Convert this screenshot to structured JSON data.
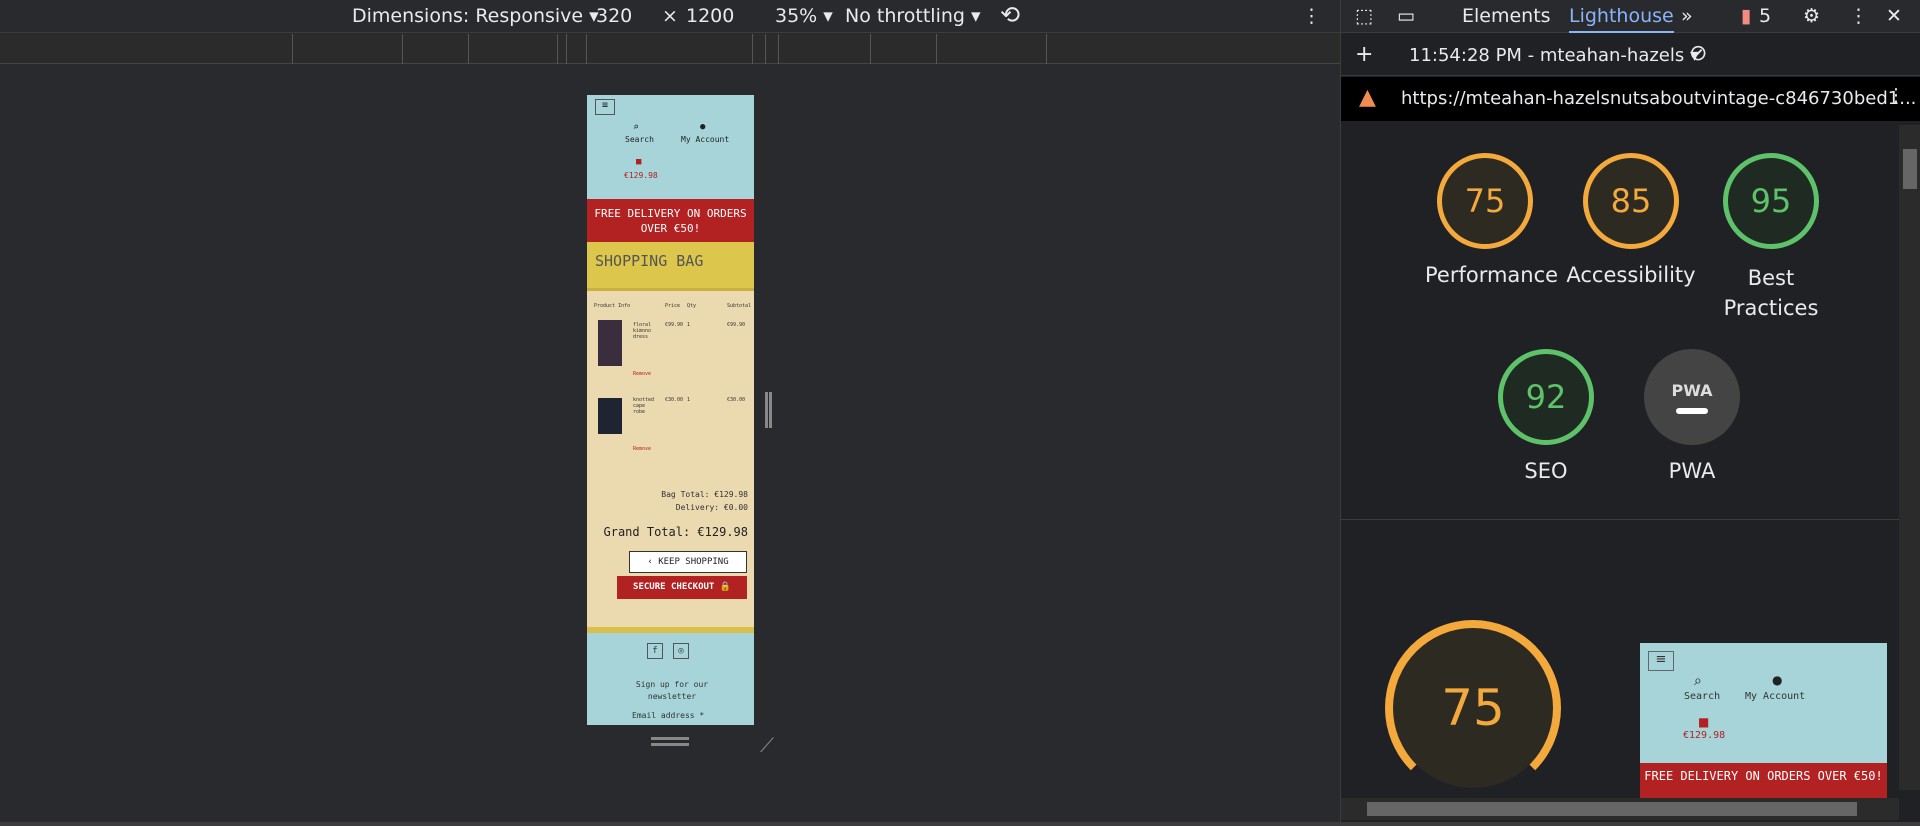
{
  "devtools_toolbar": {
    "dimensions_label": "Dimensions: Responsive",
    "width": "320",
    "times": "×",
    "height": "1200",
    "zoom": "35%",
    "throttling": "No throttling"
  },
  "viewport": {
    "header": {
      "search_label": "Search",
      "account_label": "My Account",
      "bag_total": "€129.98"
    },
    "promo": "FREE DELIVERY ON ORDERS OVER €50!",
    "title": "SHOPPING BAG",
    "table_headers": [
      "Product Info",
      "Price",
      "Qty",
      "Subtotal"
    ],
    "items": [
      {
        "name": "floral kimono dress",
        "price": "€99.90",
        "qty": "1",
        "subtotal": "€99.90",
        "remove": "Remove"
      },
      {
        "name": "knotted cape robe",
        "price": "€30.00",
        "qty": "1",
        "subtotal": "€30.00",
        "remove": "Remove"
      }
    ],
    "bag_total": "Bag Total: €129.98",
    "delivery": "Delivery: €0.00",
    "grand_total": "Grand Total: €129.98",
    "keep_shopping": "KEEP SHOPPING",
    "secure_checkout": "SECURE CHECKOUT",
    "footer": {
      "newsletter": "Sign up for our newsletter",
      "email_label": "Email address *"
    }
  },
  "devtools_panel": {
    "tabs": [
      "Elements",
      "Lighthouse"
    ],
    "active_tab": "Lighthouse",
    "issues_count": "5",
    "report_label": "11:54:28 PM - mteahan-hazels",
    "url": "https://mteahan-hazelsnutsaboutvintage-c846730bed1...",
    "scores": [
      {
        "label": "Performance",
        "value": 75,
        "color": "#f4a93d"
      },
      {
        "label": "Accessibility",
        "value": 85,
        "color": "#f4a93d"
      },
      {
        "label": "Best Practices",
        "value": 95,
        "color": "#5ec26a"
      },
      {
        "label": "SEO",
        "value": 92,
        "color": "#5ec26a"
      },
      {
        "label": "PWA",
        "value": null,
        "color": "#444"
      }
    ],
    "big_score": "75",
    "thumb": {
      "search_label": "Search",
      "account_label": "My Account",
      "bag_total": "€129.98",
      "promo": "FREE DELIVERY ON ORDERS OVER €50!"
    }
  }
}
